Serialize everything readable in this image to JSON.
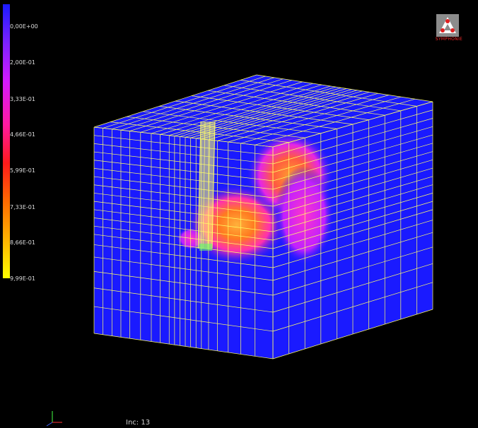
{
  "colorbar": {
    "ticks": [
      "0,00E+00",
      "2,00E-01",
      "3,33E-01",
      "4,66E-01",
      "5,99E-01",
      "7,33E-01",
      "8,66E-01",
      "9,99E-01"
    ]
  },
  "logo": {
    "text": "SYMPHONIE"
  },
  "status": {
    "inc_label": "Inc:",
    "inc_value": "13"
  },
  "colors": {
    "background": "#000000",
    "mesh_face": "#1a1aff",
    "grid_lines": "#ffff66",
    "hot": "#ff8a2a",
    "warm": "#ff33cc"
  }
}
